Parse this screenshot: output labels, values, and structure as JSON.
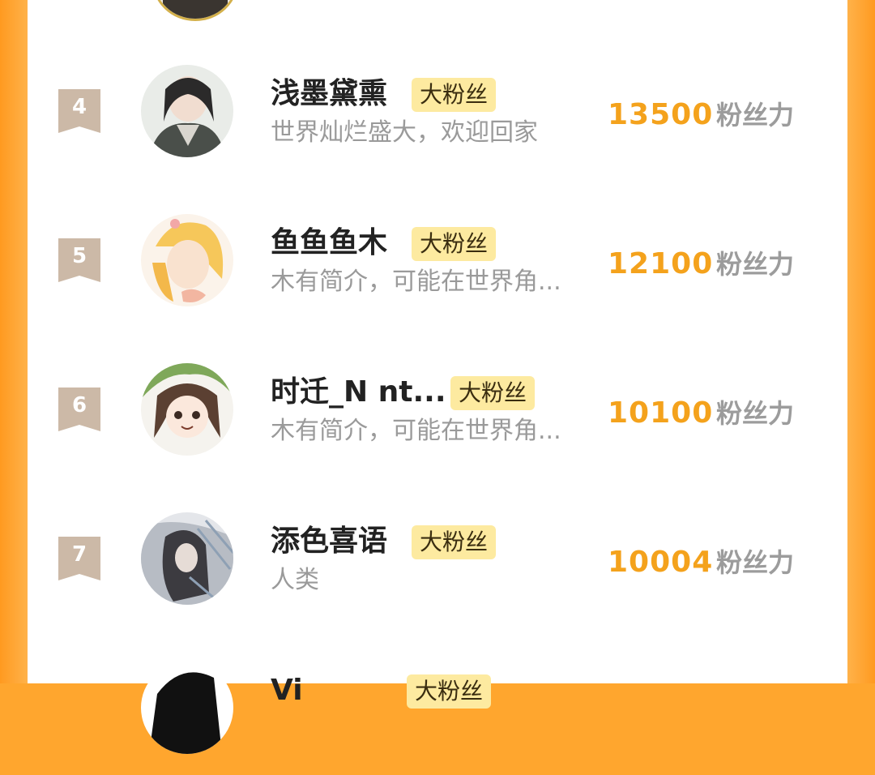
{
  "rows": [
    {
      "rank": "4",
      "name": "浅墨黛熏",
      "tag": "大粉丝",
      "bio": "世界灿烂盛大，欢迎回家",
      "score": "13500",
      "unit": "粉丝力"
    },
    {
      "rank": "5",
      "name": "鱼鱼鱼木",
      "tag": "大粉丝",
      "bio": "木有简介，可能在世界角...",
      "score": "12100",
      "unit": "粉丝力"
    },
    {
      "rank": "6",
      "name": "时迁_N nt...",
      "tag": "大粉丝",
      "bio": "木有简介，可能在世界角...",
      "score": "10100",
      "unit": "粉丝力"
    },
    {
      "rank": "7",
      "name": "添色喜语",
      "tag": "大粉丝",
      "bio": "人类",
      "score": "10004",
      "unit": "粉丝力"
    },
    {
      "rank": "",
      "name": "Vi",
      "tag": "大粉丝",
      "bio": "",
      "score": "",
      "unit": ""
    }
  ],
  "colors": {
    "frame": "#ffa62e",
    "score": "#f4a21c",
    "tag_bg": "#fdeaa0",
    "badge": "#ccb9a7"
  }
}
